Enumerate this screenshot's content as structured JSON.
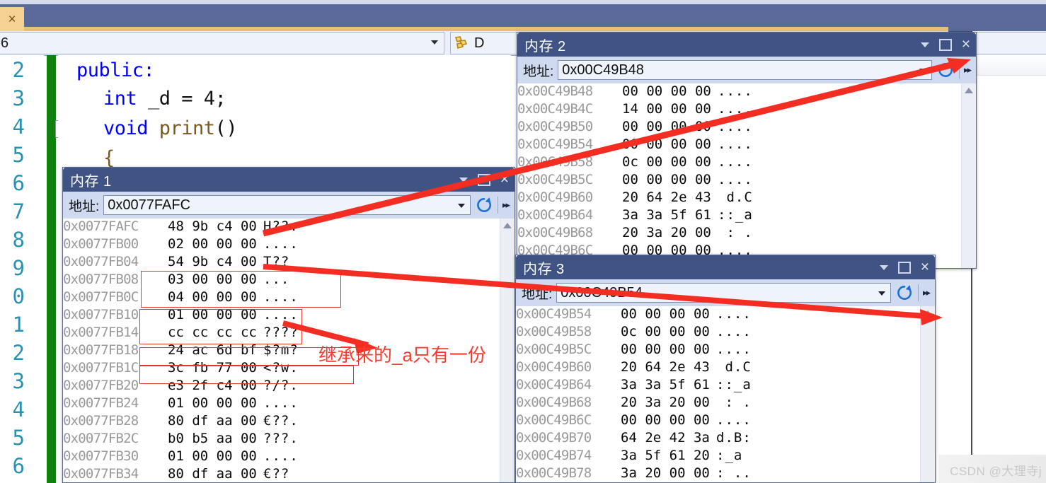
{
  "tabstrip": {
    "close_label": "×"
  },
  "navbar": {
    "left_combo_value": "6",
    "right_combo_value": "D",
    "right_combo_icon": "wrench-tools-icon"
  },
  "editor": {
    "line_numbers": [
      "2",
      "3",
      "4",
      "5",
      "6",
      "7",
      "8",
      "9",
      "0",
      "1",
      "2",
      "3",
      "4",
      "5",
      "6"
    ],
    "lines": [
      {
        "indent": 0,
        "tokens": [
          {
            "t": "public:",
            "c": "kw"
          }
        ]
      },
      {
        "indent": 1,
        "tokens": [
          {
            "t": "int ",
            "c": "kw"
          },
          {
            "t": "_d = 4;",
            "c": "pl"
          }
        ]
      },
      {
        "indent": 1,
        "tokens": [
          {
            "t": "void ",
            "c": "kw"
          },
          {
            "t": "print",
            "c": "fn"
          },
          {
            "t": "()",
            "c": "pl"
          }
        ]
      },
      {
        "indent": 1,
        "tokens": [
          {
            "t": "{",
            "c": "fn"
          }
        ]
      }
    ],
    "breakpoint_glyph": "step-into-glyph",
    "fold_glyph": "collapse-minus"
  },
  "windows": [
    {
      "id": "memory-1",
      "title": "内存 1",
      "address_label": "地址:",
      "address_value": "0x0077FAFC",
      "refresh_icon": "refresh-icon",
      "overflow_icon": "chevron-double-right-icon",
      "controls": {
        "dropdown": "window-menu-caret",
        "maximize": "maximize-box",
        "close": "×"
      },
      "rows": [
        {
          "addr": "0x0077FAFC",
          "hex": "48 9b c4 00",
          "ascii": "H??."
        },
        {
          "addr": "0x0077FB00",
          "hex": "02 00 00 00",
          "ascii": "...."
        },
        {
          "addr": "0x0077FB04",
          "hex": "54 9b c4 00",
          "ascii": "T??"
        },
        {
          "addr": "0x0077FB08",
          "hex": "03 00 00 00",
          "ascii": "..."
        },
        {
          "addr": "0x0077FB0C",
          "hex": "04 00 00 00",
          "ascii": "...."
        },
        {
          "addr": "0x0077FB10",
          "hex": "01 00 00 00",
          "ascii": "...."
        },
        {
          "addr": "0x0077FB14",
          "hex": "cc cc cc cc",
          "ascii": "????"
        },
        {
          "addr": "0x0077FB18",
          "hex": "24 ac 6d bf",
          "ascii": "$?m?"
        },
        {
          "addr": "0x0077FB1C",
          "hex": "3c fb 77 00",
          "ascii": "<?w."
        },
        {
          "addr": "0x0077FB20",
          "hex": "e3 2f c4 00",
          "ascii": "?/?."
        },
        {
          "addr": "0x0077FB24",
          "hex": "01 00 00 00",
          "ascii": "...."
        },
        {
          "addr": "0x0077FB28",
          "hex": "80 df aa 00",
          "ascii": "€??."
        },
        {
          "addr": "0x0077FB2C",
          "hex": "b0 b5 aa 00",
          "ascii": "???."
        },
        {
          "addr": "0x0077FB30",
          "hex": "01 00 00 00",
          "ascii": "...."
        },
        {
          "addr": "0x0077FB34",
          "hex": "80 df aa 00",
          "ascii": "€??"
        }
      ]
    },
    {
      "id": "memory-2",
      "title": "内存 2",
      "address_label": "地址:",
      "address_value": "0x00C49B48",
      "refresh_icon": "refresh-icon",
      "overflow_icon": "chevron-double-right-icon",
      "controls": {
        "dropdown": "window-menu-caret",
        "maximize": "maximize-box",
        "close": "×"
      },
      "rows": [
        {
          "addr": "0x00C49B48",
          "hex": "00 00 00 00",
          "ascii": "...."
        },
        {
          "addr": "0x00C49B4C",
          "hex": "14 00 00 00",
          "ascii": "...."
        },
        {
          "addr": "0x00C49B50",
          "hex": "00 00 00 00",
          "ascii": "...."
        },
        {
          "addr": "0x00C49B54",
          "hex": "00 00 00 00",
          "ascii": "...."
        },
        {
          "addr": "0x00C49B58",
          "hex": "0c 00 00 00",
          "ascii": "...."
        },
        {
          "addr": "0x00C49B5C",
          "hex": "00 00 00 00",
          "ascii": "...."
        },
        {
          "addr": "0x00C49B60",
          "hex": "20 64 2e 43",
          "ascii": " d.C"
        },
        {
          "addr": "0x00C49B64",
          "hex": "3a 3a 5f 61",
          "ascii": "::_a"
        },
        {
          "addr": "0x00C49B68",
          "hex": "20 3a 20 00",
          "ascii": " : ."
        },
        {
          "addr": "0x00C49B6C",
          "hex": "00 00 00 00",
          "ascii": "...."
        }
      ]
    },
    {
      "id": "memory-3",
      "title": "内存 3",
      "address_label": "地址:",
      "address_value": "0x00C49B54",
      "refresh_icon": "refresh-icon",
      "overflow_icon": "chevron-double-right-icon",
      "controls": {
        "dropdown": "window-menu-caret",
        "maximize": "maximize-box",
        "close": "×"
      },
      "rows": [
        {
          "addr": "0x00C49B54",
          "hex": "00 00 00 00",
          "ascii": "...."
        },
        {
          "addr": "0x00C49B58",
          "hex": "0c 00 00 00",
          "ascii": "...."
        },
        {
          "addr": "0x00C49B5C",
          "hex": "00 00 00 00",
          "ascii": "...."
        },
        {
          "addr": "0x00C49B60",
          "hex": "20 64 2e 43",
          "ascii": " d.C"
        },
        {
          "addr": "0x00C49B64",
          "hex": "3a 3a 5f 61",
          "ascii": "::_a"
        },
        {
          "addr": "0x00C49B68",
          "hex": "20 3a 20 00",
          "ascii": " : ."
        },
        {
          "addr": "0x00C49B6C",
          "hex": "00 00 00 00",
          "ascii": "...."
        },
        {
          "addr": "0x00C49B70",
          "hex": "64 2e 42 3a",
          "ascii": "d.B:"
        },
        {
          "addr": "0x00C49B74",
          "hex": "3a 5f 61 20",
          "ascii": ":_a "
        },
        {
          "addr": "0x00C49B78",
          "hex": "3a 20 00 00",
          "ascii": ": .."
        }
      ]
    }
  ],
  "annotation": {
    "text": "继承来的_a只有一份",
    "color": "#fb3b30"
  },
  "watermark": {
    "text": "CSDN @大理寺j"
  },
  "colors": {
    "titlebar": "#3f5484",
    "addressbar": "#cfd9ef",
    "tab_active": "#f5d193",
    "changebar_green": "#108010",
    "annotation_red": "#fb3b30",
    "linenumber_blue": "#2b91af",
    "keyword_blue": "#0000ff"
  }
}
